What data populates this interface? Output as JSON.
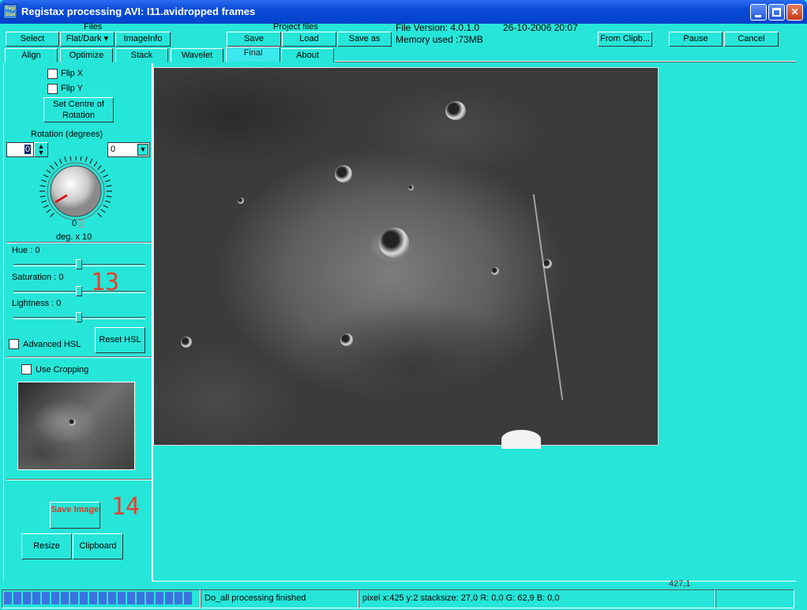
{
  "window": {
    "title": "Registax processing AVI: I11.avidropped frames",
    "icon_text": "Regi Stax"
  },
  "toolbar": {
    "files_group": "Files",
    "select": "Select",
    "flat_dark": "Flat/Dark",
    "image_info": "ImageInfo",
    "project_group": "Project files",
    "save": "Save",
    "load": "Load",
    "save_as": "Save as",
    "file_version": "File Version: 4.0.1.0",
    "date": "26-10-2006 20:07",
    "memory": "Memory used :73MB",
    "from_clipboard": "From Clipb...",
    "pause": "Pause",
    "cancel": "Cancel"
  },
  "tabs": [
    {
      "label": "Align"
    },
    {
      "label": "Optimize"
    },
    {
      "label": "Stack"
    },
    {
      "label": "Wavelet"
    },
    {
      "label": "Final",
      "active": true
    },
    {
      "label": "About"
    }
  ],
  "left_panel": {
    "flip_x": "Flip X",
    "flip_y": "Flip Y",
    "set_centre": "Set Centre of Rotation",
    "rotation_label": "Rotation (degrees)",
    "rotation_value": "0",
    "rotation_select": "0",
    "dial_value": "0",
    "deg_label": "deg. x 10",
    "hue_label": "Hue : 0",
    "saturation_label": "Saturation : 0",
    "lightness_label": "Lightness : 0",
    "advanced_hsl": "Advanced HSL",
    "reset_hsl": "Reset HSL",
    "use_cropping": "Use Cropping",
    "save_image": "Save Image",
    "resize": "Resize",
    "clipboard": "Clipboard"
  },
  "annotations": {
    "a13": "13",
    "a14": "14"
  },
  "image_coords": "427,1",
  "status": {
    "message": "Do_all processing finished",
    "pixel_info": "pixel x:425 y:2 stacksize: 27,0 R: 0,0 G: 62,9 B: 0,0",
    "progress_blocks": 20
  },
  "colors": {
    "background": "#26E6D9",
    "title_bar": "#0A4BD8",
    "annotation": "#E8402A",
    "progress": "#3A73E0"
  }
}
